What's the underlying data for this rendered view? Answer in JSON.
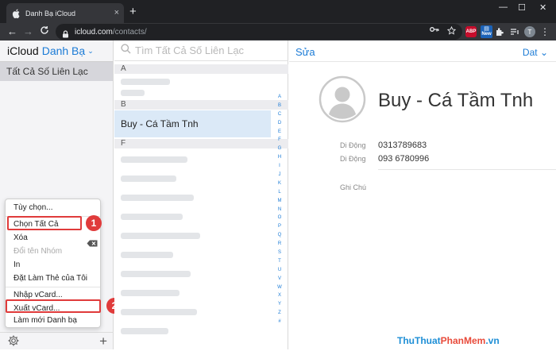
{
  "browser": {
    "tab_title": "Danh Bạ iCloud",
    "tab_close": "×",
    "new_tab": "+",
    "window_controls": [
      "—",
      "☐",
      "✕"
    ],
    "url_host": "icloud.com",
    "url_path": "/contacts/",
    "nav": {
      "back": "←",
      "forward": "→",
      "reload": "C"
    },
    "omni_icons": [
      "key-icon",
      "star-icon"
    ],
    "extensions": {
      "abp": "ABP",
      "new_badge": "New",
      "profile_initial": "T"
    }
  },
  "sidebar": {
    "brand": "iCloud",
    "app_name": "Danh Bạ",
    "app_chevron": "⌄",
    "group": "Tất Cả Số Liên Lạc",
    "plus": "+"
  },
  "menu": {
    "items": [
      {
        "label": "Tùy chọn...",
        "disabled": false
      },
      {
        "label": "Chọn Tất Cả",
        "disabled": false
      },
      {
        "label": "Xóa",
        "disabled": false
      },
      {
        "label": "Đổi tên Nhóm",
        "disabled": true
      },
      {
        "label": "In",
        "disabled": false
      },
      {
        "label": "Đặt Làm Thẻ của Tôi",
        "disabled": false
      },
      {
        "label": "Nhập vCard...",
        "disabled": false
      },
      {
        "label": "Xuất vCard...",
        "disabled": false
      },
      {
        "label": "Làm mới Danh bạ",
        "disabled": false
      }
    ],
    "callouts": [
      "1",
      "2"
    ]
  },
  "list": {
    "search_placeholder": "Tìm Tất Cả Số Liên Lạc",
    "sections": [
      "A",
      "B",
      "F"
    ],
    "selected_contact": "Buy - Cá Tầm Tnh",
    "alpha_index": [
      "A",
      "B",
      "C",
      "D",
      "E",
      "F",
      "G",
      "H",
      "I",
      "J",
      "K",
      "L",
      "M",
      "N",
      "O",
      "P",
      "Q",
      "R",
      "S",
      "T",
      "U",
      "V",
      "W",
      "X",
      "Y",
      "Z",
      "#"
    ]
  },
  "detail": {
    "edit": "Sửa",
    "share": "Dat",
    "name": "Buy - Cá Tầm Tnh",
    "phones": [
      {
        "label": "Di Động",
        "value": "0313789683"
      },
      {
        "label": "Di Động",
        "value": "093 6780996"
      }
    ],
    "notes_label": "Ghi Chú"
  },
  "watermark": {
    "part1": "ThuThuat",
    "part2": "PhanMem",
    "part3": ".vn"
  },
  "colors": {
    "accent": "#1b7bd6",
    "highlight": "#e03b3b",
    "selected_row": "#dbe9f7"
  }
}
